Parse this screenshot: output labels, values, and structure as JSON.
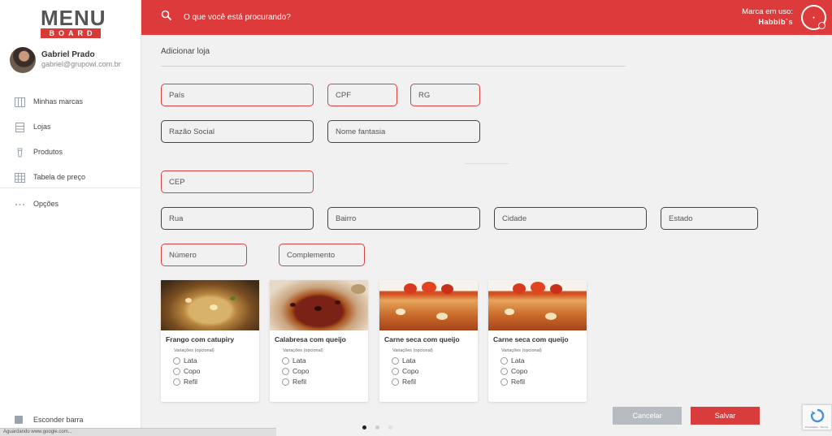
{
  "logo": {
    "top": "MENU",
    "bottom": "BOARD"
  },
  "profile": {
    "name": "Gabriel Prado",
    "email": "gabriel@grupowi.com.br"
  },
  "sidebar": {
    "items": [
      {
        "label": "Minhas marcas",
        "icon": "columns-icon"
      },
      {
        "label": "Lojas",
        "icon": "store-icon"
      },
      {
        "label": "Produtos",
        "icon": "cup-icon"
      },
      {
        "label": "Tabela de preço",
        "icon": "table-icon"
      },
      {
        "label": "Opções",
        "icon": "more-dots-icon"
      }
    ],
    "hide_label": "Esconder barra"
  },
  "topbar": {
    "search_placeholder": "O que você está procurando?",
    "brand_label": "Marca em uso:",
    "brand_name": "Habbib`s",
    "accent": "#dd3b3b"
  },
  "main": {
    "title": "Adicionar loja",
    "fields": {
      "pais": "País",
      "cpf": "CPF",
      "rg": "RG",
      "razao_social": "Razão Social",
      "nome_fantasia": "Nome fantasia",
      "cep": "CEP",
      "rua": "Rua",
      "bairro": "Bairro",
      "cidade": "Cidade",
      "estado": "Estado",
      "numero": "Número",
      "complemento": "Complemento"
    },
    "products": [
      {
        "title": "Frango com catupiry",
        "variations_label": "Variações (opcional)",
        "options": [
          "Lata",
          "Copo",
          "Refil"
        ]
      },
      {
        "title": "Calabresa com queijo",
        "variations_label": "Variações (opcional)",
        "options": [
          "Lata",
          "Copo",
          "Refil"
        ]
      },
      {
        "title": "Carne seca com queijo",
        "variations_label": "Variações (opcional)",
        "options": [
          "Lata",
          "Copo",
          "Refil"
        ]
      },
      {
        "title": "Carne seca com queijo",
        "variations_label": "Variações (opcional)",
        "options": [
          "Lata",
          "Copo",
          "Refil"
        ]
      }
    ],
    "buttons": {
      "cancel": "Cancelar",
      "save": "Salvar"
    }
  },
  "status": "Aguardando www.google.com...",
  "recaptcha": "Privacidade - Termos"
}
